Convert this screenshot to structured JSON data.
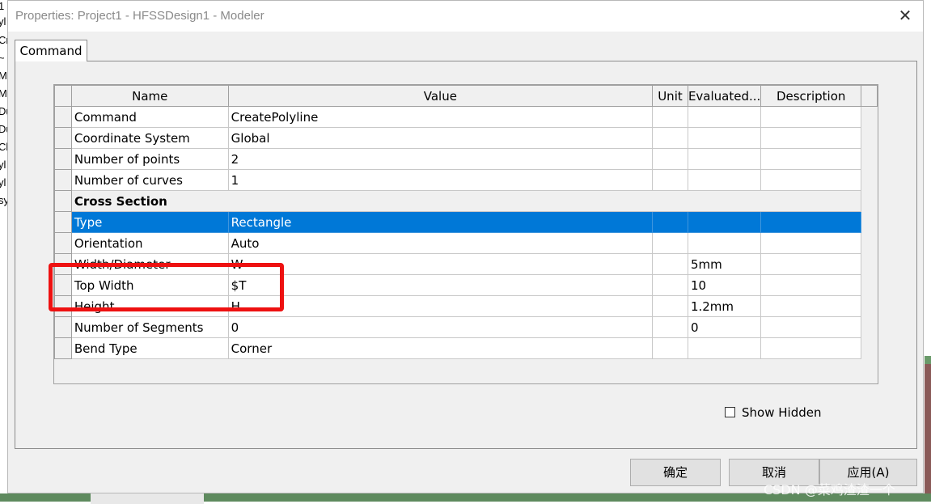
{
  "background": {
    "left_fragments": [
      "1",
      "yl",
      "Cr",
      "~",
      "M",
      "M",
      "Du",
      "Du",
      "Cl",
      "yl",
      "yl",
      "sy"
    ]
  },
  "dialog": {
    "title": "Properties: Project1 - HFSSDesign1 - Modeler",
    "close_glyph": "✕"
  },
  "tabs": [
    {
      "label": "Command",
      "active": true
    }
  ],
  "grid": {
    "columns": [
      "Name",
      "Value",
      "Unit",
      "Evaluated...",
      "Description"
    ],
    "rows": [
      {
        "name": "Command",
        "value": "CreatePolyline",
        "unit": "",
        "evaluated": "",
        "description": ""
      },
      {
        "name": "Coordinate System",
        "value": "Global",
        "unit": "",
        "evaluated": "",
        "description": ""
      },
      {
        "name": "Number of points",
        "value": "2",
        "unit": "",
        "evaluated": "",
        "description": ""
      },
      {
        "name": "Number of curves",
        "value": "1",
        "unit": "",
        "evaluated": "",
        "description": ""
      },
      {
        "name": "Cross Section",
        "section": true
      },
      {
        "name": "Type",
        "value": "Rectangle",
        "unit": "",
        "evaluated": "",
        "description": "",
        "selected": true
      },
      {
        "name": "Orientation",
        "value": "Auto",
        "unit": "",
        "evaluated": "",
        "description": ""
      },
      {
        "name": "Width/Diameter",
        "value": "W",
        "unit": "",
        "evaluated": "5mm",
        "description": ""
      },
      {
        "name": "Top Width",
        "value": "$T",
        "unit": "",
        "evaluated": "10",
        "description": ""
      },
      {
        "name": "Height",
        "value": "H",
        "unit": "",
        "evaluated": "1.2mm",
        "description": ""
      },
      {
        "name": "Number of Segments",
        "value": "0",
        "unit": "",
        "evaluated": "0",
        "description": ""
      },
      {
        "name": "Bend Type",
        "value": "Corner",
        "unit": "",
        "evaluated": "",
        "description": ""
      }
    ]
  },
  "show_hidden": {
    "label": "Show Hidden",
    "checked": false
  },
  "buttons": {
    "ok": "确定",
    "cancel": "取消",
    "apply": "应用(A)"
  },
  "watermark": "CSDN @菜鸡渣渣一个",
  "colors": {
    "selection": "#0078d7",
    "highlight_border": "#ee1111"
  }
}
